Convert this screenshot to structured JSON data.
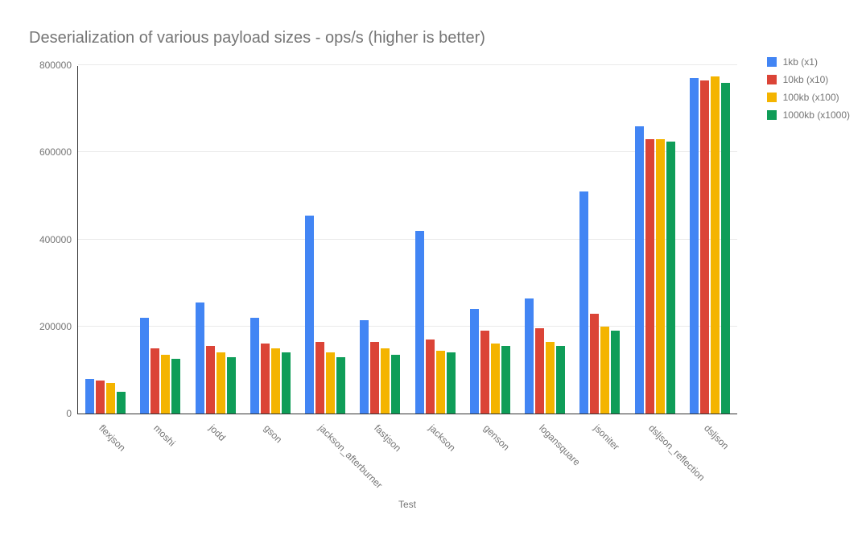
{
  "title": "Deserialization of various payload sizes  - ops/s (higher is better)",
  "x_axis_title": "Test",
  "legend": [
    {
      "label": "1kb (x1)",
      "color": "#4285F4"
    },
    {
      "label": "10kb (x10)",
      "color": "#DB4437"
    },
    {
      "label": "100kb (x100)",
      "color": "#F4B400"
    },
    {
      "label": "1000kb (x1000)",
      "color": "#0F9D58"
    }
  ],
  "y_ticks": [
    0,
    200000,
    400000,
    600000,
    800000
  ],
  "chart_data": {
    "type": "bar",
    "title": "Deserialization of various payload sizes  - ops/s (higher is better)",
    "xlabel": "Test",
    "ylabel": "",
    "ylim": [
      0,
      800000
    ],
    "categories": [
      "flexjson",
      "moshi",
      "jodd",
      "gson",
      "jackson_afterburner",
      "fastjson",
      "jackson",
      "genson",
      "logansquare",
      "jsoniter",
      "dsljson_reflection",
      "dsljson"
    ],
    "series": [
      {
        "name": "1kb (x1)",
        "color": "#4285F4",
        "values": [
          80000,
          220000,
          255000,
          220000,
          455000,
          215000,
          420000,
          240000,
          265000,
          510000,
          660000,
          770000
        ]
      },
      {
        "name": "10kb (x10)",
        "color": "#DB4437",
        "values": [
          75000,
          150000,
          155000,
          160000,
          165000,
          165000,
          170000,
          190000,
          195000,
          230000,
          630000,
          765000
        ]
      },
      {
        "name": "100kb (x100)",
        "color": "#F4B400",
        "values": [
          70000,
          135000,
          140000,
          150000,
          140000,
          150000,
          145000,
          160000,
          165000,
          200000,
          630000,
          775000
        ]
      },
      {
        "name": "1000kb (x1000)",
        "color": "#0F9D58",
        "values": [
          50000,
          125000,
          130000,
          140000,
          130000,
          135000,
          140000,
          155000,
          155000,
          190000,
          625000,
          760000
        ]
      }
    ]
  }
}
